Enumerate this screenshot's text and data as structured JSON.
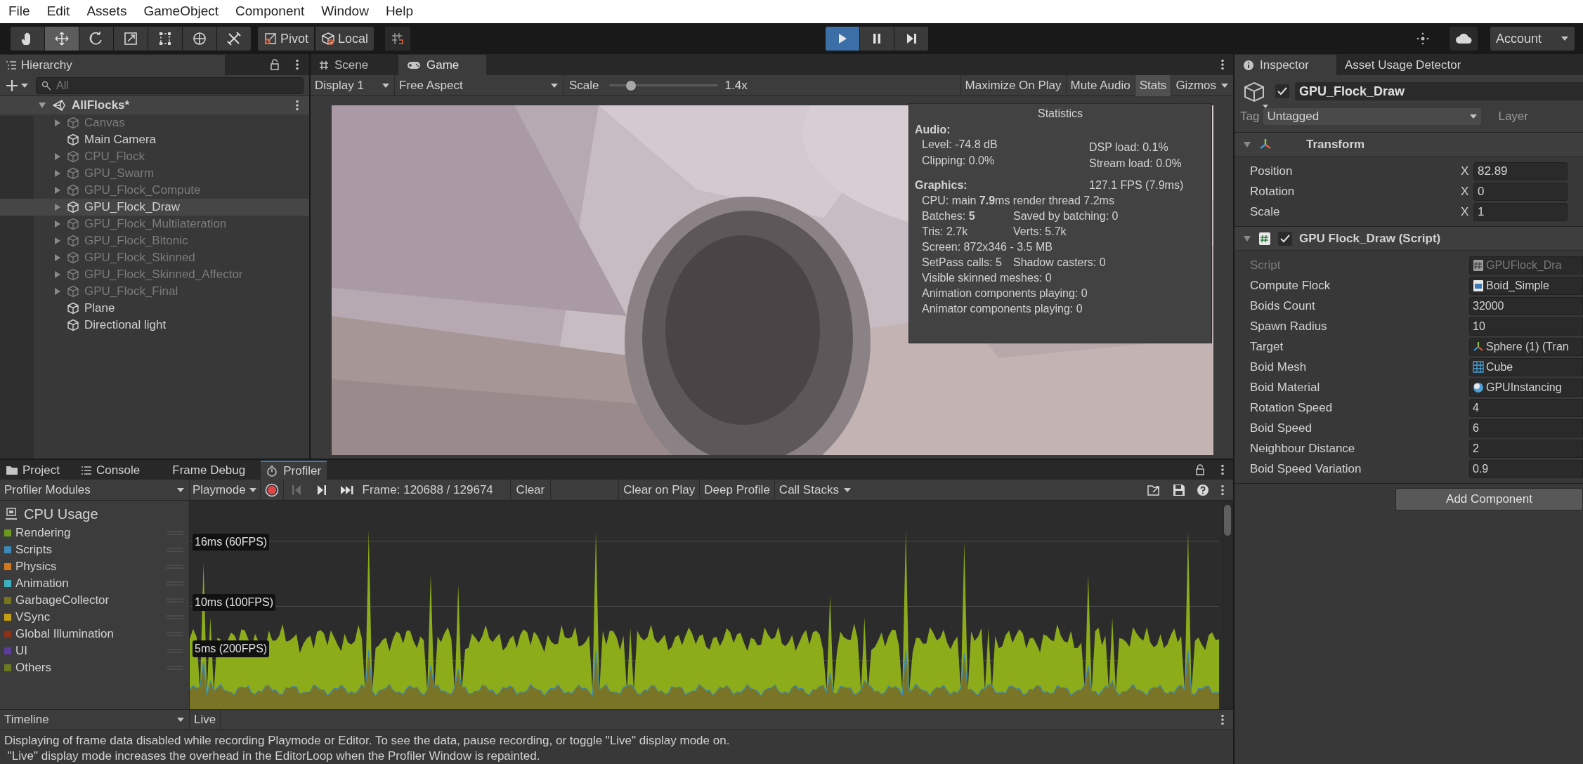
{
  "menu_bar": [
    "File",
    "Edit",
    "Assets",
    "GameObject",
    "Component",
    "Window",
    "Help"
  ],
  "toolbar": {
    "tools": [
      {
        "kind": "hand",
        "selected": false
      },
      {
        "kind": "move",
        "selected": true
      },
      {
        "kind": "rotate",
        "selected": false
      },
      {
        "kind": "scale",
        "selected": false
      },
      {
        "kind": "rect",
        "selected": false
      },
      {
        "kind": "transform",
        "selected": false
      },
      {
        "kind": "custom",
        "selected": false
      }
    ],
    "pivot": "Pivot",
    "space": "Local",
    "playing": true,
    "paused": false,
    "account": "Account"
  },
  "hierarchy": {
    "title": "Hierarchy",
    "search_placeholder": "All",
    "scene": {
      "label": "AllFlocks*",
      "expanded": true,
      "children": [
        {
          "label": "Canvas",
          "active": false,
          "selected": false,
          "expandable": true
        },
        {
          "label": "Main Camera",
          "active": true,
          "selected": false,
          "expandable": false
        },
        {
          "label": "CPU_Flock",
          "active": false,
          "selected": false,
          "expandable": true
        },
        {
          "label": "GPU_Swarm",
          "active": false,
          "selected": false,
          "expandable": true
        },
        {
          "label": "GPU_Flock_Compute",
          "active": false,
          "selected": false,
          "expandable": true
        },
        {
          "label": "GPU_Flock_Draw",
          "active": true,
          "selected": true,
          "expandable": true
        },
        {
          "label": "GPU_Flock_Multilateration",
          "active": false,
          "selected": false,
          "expandable": true
        },
        {
          "label": "GPU_Flock_Bitonic",
          "active": false,
          "selected": false,
          "expandable": true
        },
        {
          "label": "GPU_Flock_Skinned",
          "active": false,
          "selected": false,
          "expandable": true
        },
        {
          "label": "GPU_Flock_Skinned_Affector",
          "active": false,
          "selected": false,
          "expandable": true
        },
        {
          "label": "GPU_Flock_Final",
          "active": false,
          "selected": false,
          "expandable": true
        },
        {
          "label": "Plane",
          "active": true,
          "selected": false,
          "expandable": false
        },
        {
          "label": "Directional light",
          "active": true,
          "selected": false,
          "expandable": false
        }
      ]
    }
  },
  "game_view": {
    "tabs": [
      {
        "label": "Scene",
        "selected": false,
        "kind": "scene"
      },
      {
        "label": "Game",
        "selected": true,
        "kind": "game"
      }
    ],
    "display": "Display 1",
    "aspect": "Free Aspect",
    "scale_label": "Scale",
    "scale": {
      "level": 0.2
    },
    "scale_value": "1.4x",
    "buttons": [
      {
        "label": "Maximize On Play",
        "on": false,
        "kind": "toggle"
      },
      {
        "label": "Mute Audio",
        "on": false,
        "kind": "toggle"
      },
      {
        "label": "Stats",
        "on": true,
        "kind": "toggle"
      },
      {
        "label": "Gizmos",
        "on": false,
        "kind": "dropdown"
      }
    ],
    "statistics": {
      "title": "Statistics",
      "audio_heading": "Audio:",
      "audio_rows": [
        {
          "left": "Level: -74.8 dB",
          "right": "DSP load: 0.1%"
        },
        {
          "left": "Clipping: 0.0%",
          "right": "Stream load: 0.0%"
        }
      ],
      "graphics_heading": "Graphics:",
      "fps": "127.1 FPS (7.9ms)",
      "graphics_rows": [
        {
          "left": "CPU: main **7.9**ms  render thread 7.2ms"
        },
        {
          "left": "Batches: **5**",
          "right": "Saved by batching: 0"
        },
        {
          "left": "Tris: 2.7k",
          "right": "Verts: 5.7k"
        },
        {
          "left": "Screen: 872x346 - 3.5 MB"
        },
        {
          "left": "SetPass calls: 5",
          "right": "Shadow casters: 0"
        },
        {
          "left": "Visible skinned meshes: 0"
        },
        {
          "left": "Animation components playing: 0"
        },
        {
          "left": "Animator components playing: 0"
        }
      ]
    }
  },
  "inspector": {
    "tabs": [
      {
        "label": "Inspector",
        "selected": true
      },
      {
        "label": "Asset Usage Detector",
        "selected": false
      }
    ],
    "object": {
      "active": true,
      "name": "GPU_Flock_Draw",
      "tag_label": "Tag",
      "tag": "Untagged",
      "layer_label": "Layer"
    },
    "transform": {
      "title": "Transform",
      "expanded": true,
      "rows": [
        {
          "label": "Position",
          "axis": "X",
          "value": "82.89"
        },
        {
          "label": "Rotation",
          "axis": "X",
          "value": "0"
        },
        {
          "label": "Scale",
          "axis": "X",
          "value": "1"
        }
      ]
    },
    "script_component": {
      "title": "GPU Flock_Draw (Script)",
      "expanded": true,
      "enabled": true,
      "fields": [
        {
          "label": "Script",
          "kind": "script",
          "value": "GPUFlock_Dra",
          "disabled": true
        },
        {
          "label": "Compute Flock",
          "kind": "compute",
          "value": "Boid_Simple",
          "disabled": false
        },
        {
          "label": "Boids Count",
          "kind": "number",
          "value": "32000",
          "disabled": false
        },
        {
          "label": "Spawn Radius",
          "kind": "number",
          "value": "10",
          "disabled": false
        },
        {
          "label": "Target",
          "kind": "transform",
          "value": "Sphere (1) (Tran",
          "disabled": false
        },
        {
          "label": "Boid Mesh",
          "kind": "mesh",
          "value": "Cube",
          "disabled": false
        },
        {
          "label": "Boid Material",
          "kind": "material",
          "value": "GPUInstancing",
          "disabled": false
        },
        {
          "label": "Rotation Speed",
          "kind": "number",
          "value": "4",
          "disabled": false
        },
        {
          "label": "Boid Speed",
          "kind": "number",
          "value": "6",
          "disabled": false
        },
        {
          "label": "Neighbour Distance",
          "kind": "number",
          "value": "2",
          "disabled": false
        },
        {
          "label": "Boid Speed Variation",
          "kind": "number",
          "value": "0.9",
          "disabled": false
        }
      ]
    },
    "add_component": "Add Component"
  },
  "profiler": {
    "tabs": [
      {
        "label": "Project",
        "selected": false,
        "kind": "folder"
      },
      {
        "label": "Console",
        "selected": false,
        "kind": "console"
      },
      {
        "label": "Frame Debug",
        "selected": false,
        "kind": "plain"
      },
      {
        "label": "Profiler",
        "selected": true,
        "kind": "profiler"
      }
    ],
    "modules_label": "Profiler Modules",
    "mode": "Playmode",
    "recording": true,
    "frame": "Frame: 120688 / 129674",
    "clear": "Clear",
    "toggles": [
      {
        "label": "Clear on Play",
        "on": false,
        "kind": "toggle"
      },
      {
        "label": "Deep Profile",
        "on": false,
        "kind": "toggle"
      },
      {
        "label": "Call Stacks",
        "on": false,
        "kind": "dropdown"
      }
    ],
    "module": {
      "title": "CPU Usage",
      "legend": [
        {
          "label": "Rendering",
          "color": "#6c9a1e"
        },
        {
          "label": "Scripts",
          "color": "#3b8ab8"
        },
        {
          "label": "Physics",
          "color": "#d5761b"
        },
        {
          "label": "Animation",
          "color": "#3fb0c0"
        },
        {
          "label": "GarbageCollector",
          "color": "#76761f"
        },
        {
          "label": "VSync",
          "color": "#c49e12"
        },
        {
          "label": "Global Illumination",
          "color": "#8b3219"
        },
        {
          "label": "UI",
          "color": "#5b3c9a"
        },
        {
          "label": "Others",
          "color": "#6a7a21"
        }
      ]
    },
    "chart_labels": [
      "16ms (60FPS)",
      "10ms (100FPS)",
      "5ms (200FPS)"
    ],
    "view": "Timeline",
    "view_mode": "Live",
    "message": [
      "Displaying of frame data disabled while recording Playmode or Editor. To see the data, pause recording, or toggle \"Live\" display mode on.",
      " \"Live\" display mode increases the overhead in the EditorLoop when the Profiler Window is repainted."
    ]
  }
}
